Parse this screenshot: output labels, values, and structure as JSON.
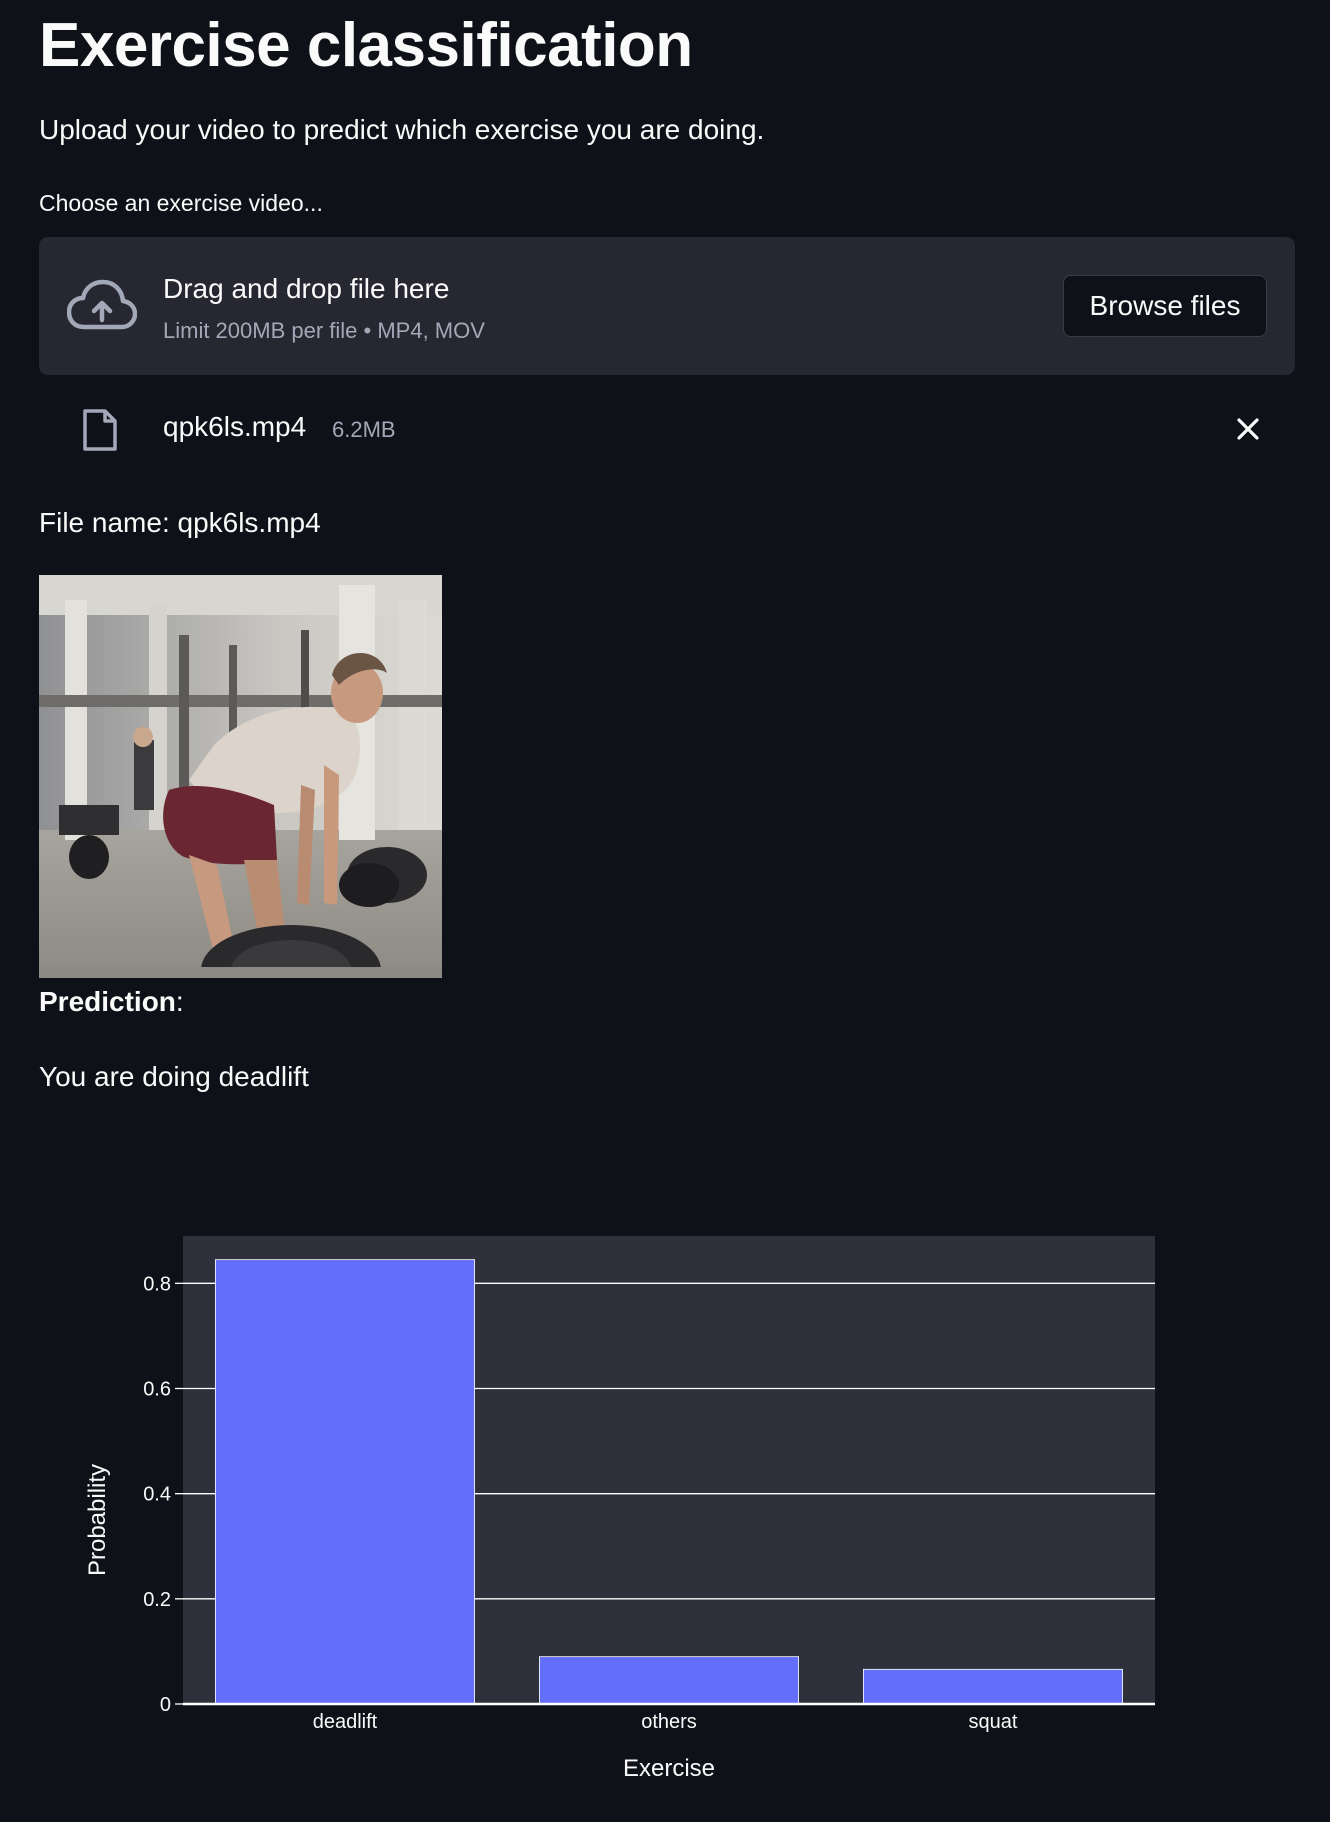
{
  "page": {
    "title": "Exercise classification",
    "subtitle": "Upload your video to predict which exercise you are doing."
  },
  "uploader": {
    "label": "Choose an exercise video...",
    "drop_title": "Drag and drop file here",
    "drop_hint": "Limit 200MB per file • MP4, MOV",
    "browse_label": "Browse files",
    "upload_icon": "cloud-upload-icon",
    "file": {
      "name": "qpk6ls.mp4",
      "size": "6.2MB",
      "file_icon": "file-icon",
      "remove_icon": "close-icon"
    }
  },
  "result": {
    "file_name_line": "File name: qpk6ls.mp4",
    "prediction_label": "Prediction",
    "prediction_colon": ":",
    "prediction_text": "You are doing deadlift"
  },
  "colors": {
    "background": "#0e1117",
    "panel": "#262730",
    "bar": "#636efa",
    "plot_bg": "#2e303c"
  },
  "chart_data": {
    "type": "bar",
    "categories": [
      "deadlift",
      "others",
      "squat"
    ],
    "values": [
      0.845,
      0.09,
      0.066
    ],
    "xlabel": "Exercise",
    "ylabel": "Probability",
    "ylim": [
      0,
      0.89
    ],
    "yticks": [
      0,
      0.2,
      0.4,
      0.6,
      0.8
    ],
    "ytick_labels": [
      "0",
      "0.2",
      "0.4",
      "0.6",
      "0.8"
    ],
    "grid": true
  }
}
